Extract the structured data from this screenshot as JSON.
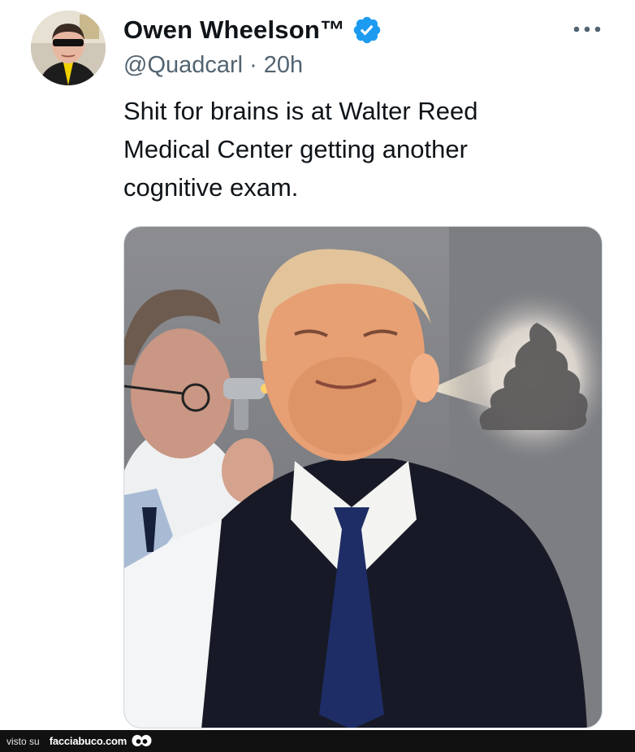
{
  "tweet": {
    "display_name": "Owen Wheelson™",
    "handle": "@Quadcarl",
    "separator": "·",
    "timestamp": "20h",
    "text_lines": [
      "Shit for brains is at Walter Reed",
      "Medical Center getting another",
      "cognitive exam."
    ],
    "verified_color": "#1d9bf0",
    "more_icon": "more-horizontal-icon"
  },
  "media": {
    "type": "photo"
  },
  "footer": {
    "prefix": "visto su",
    "brand": "facciabuco.com",
    "icon": "eyes-icon"
  },
  "colors": {
    "text": "#0f1419",
    "secondary": "#536471",
    "footer_bg": "#111111"
  }
}
